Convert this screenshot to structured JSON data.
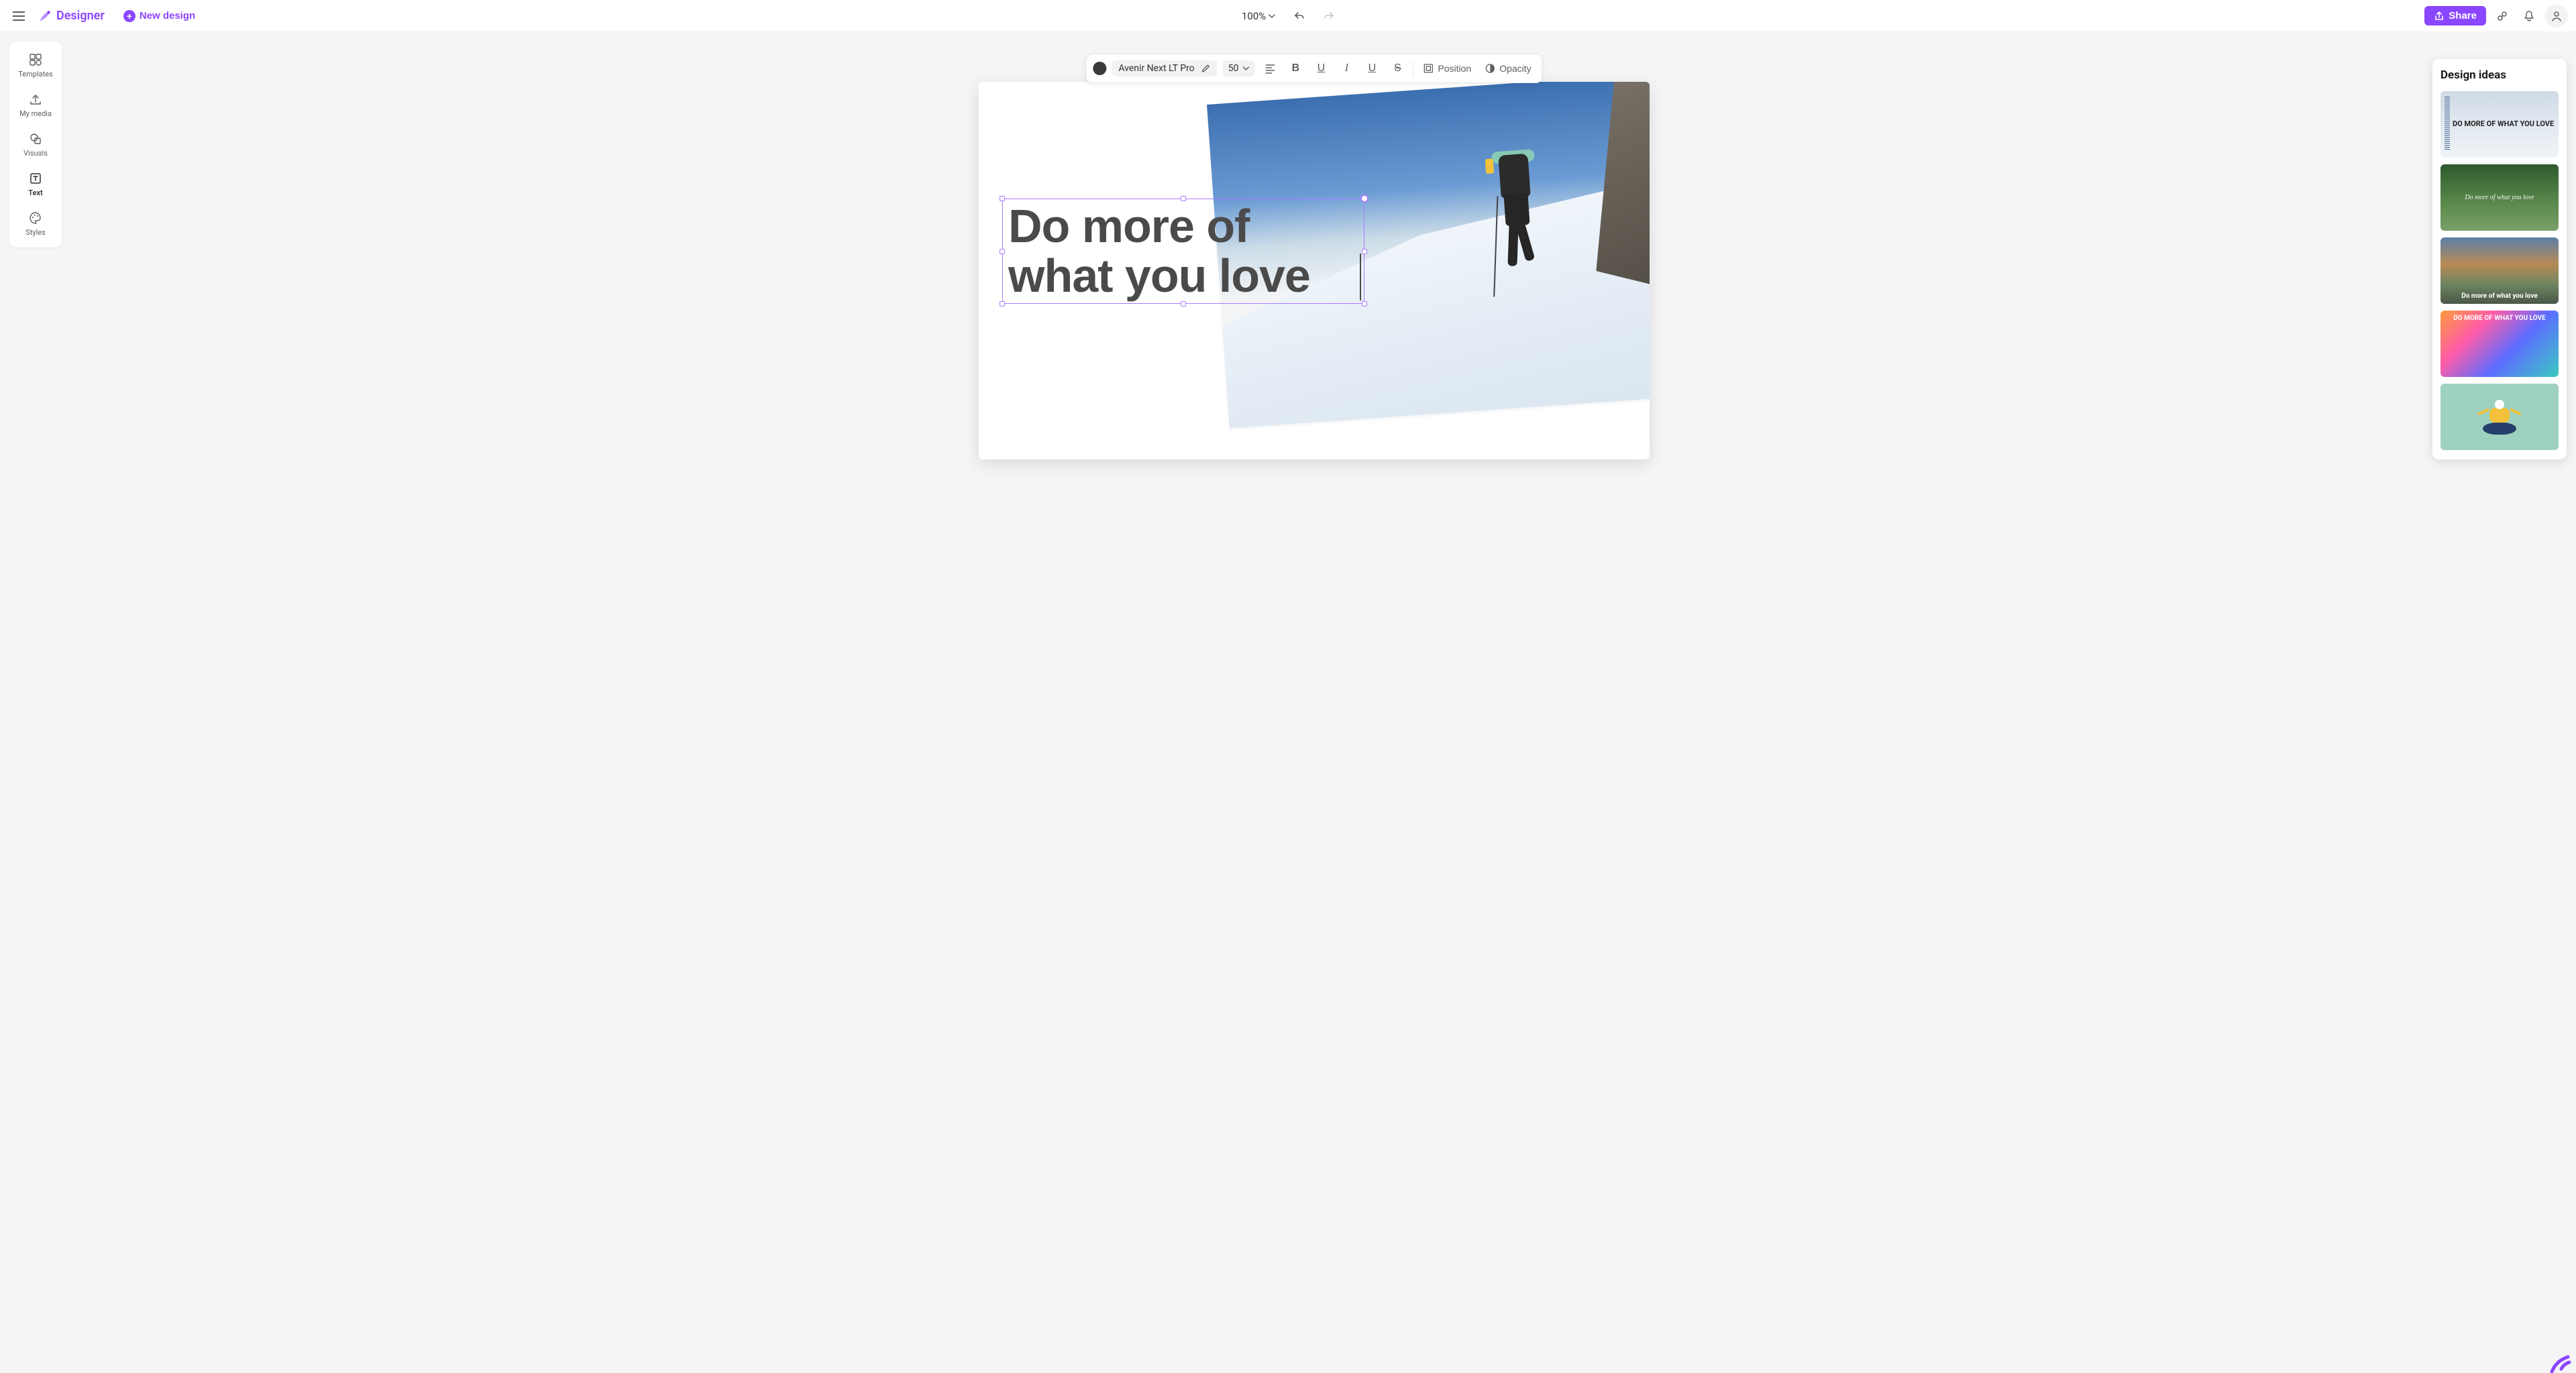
{
  "header": {
    "brand": "Designer",
    "new_design_label": "New design",
    "zoom_level": "100%",
    "share_label": "Share"
  },
  "sidebar": {
    "items": [
      {
        "label": "Templates"
      },
      {
        "label": "My media"
      },
      {
        "label": "Visuals"
      },
      {
        "label": "Text"
      },
      {
        "label": "Styles"
      }
    ]
  },
  "format": {
    "text_color": "#3b3b3b",
    "font_name": "Avenir Next LT Pro",
    "font_size": "50",
    "position_label": "Position",
    "opacity_label": "Opacity"
  },
  "canvas": {
    "headline_text": "Do more of what you love"
  },
  "ideas": {
    "title": "Design ideas",
    "cards": [
      {
        "caption": "DO MORE OF WHAT YOU LOVE"
      },
      {
        "caption": "Do more of what you love"
      },
      {
        "caption": "Do more of what you love"
      },
      {
        "caption": "DO MORE OF WHAT YOU LOVE"
      },
      {
        "caption": ""
      }
    ]
  }
}
